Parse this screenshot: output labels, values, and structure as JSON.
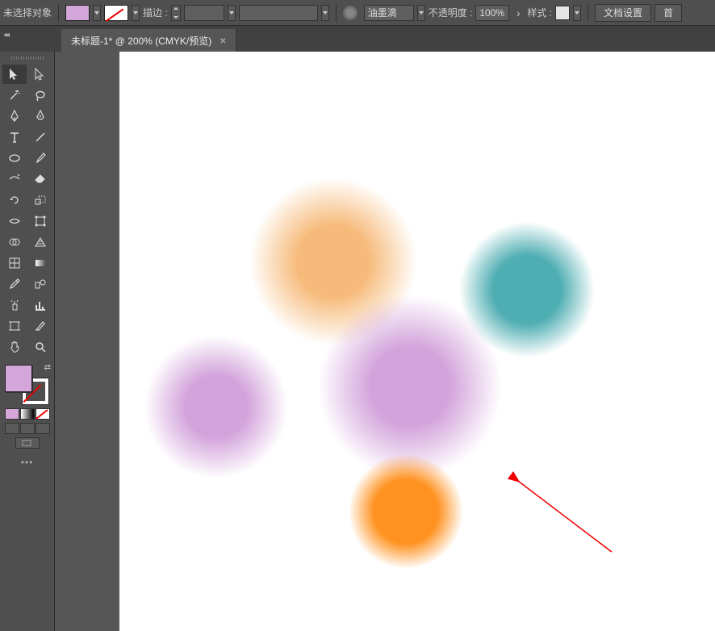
{
  "toolbar": {
    "no_selection": "未选择对象",
    "fill_color": "#d4a6da",
    "stroke_label": "描边 :",
    "stroke_value": "",
    "brush_label": "油墨滴",
    "opacity_label": "不透明度 :",
    "opacity_value": "100%",
    "style_label": "样式 :",
    "doc_settings": "文档设置",
    "prefs": "首"
  },
  "tab": {
    "title": "未标题-1* @ 200% (CMYK/预览)",
    "close": "×"
  },
  "tools": {
    "r0c0": "selection-tool",
    "r0c1": "direct-selection-tool",
    "r1c0": "magic-wand-tool",
    "r1c1": "lasso-tool",
    "r2c0": "pen-tool",
    "r2c1": "curvature-tool",
    "r3c0": "type-tool",
    "r3c1": "line-tool",
    "r4c0": "ellipse-tool",
    "r4c1": "paintbrush-tool",
    "r5c0": "pencil-tool",
    "r5c1": "eraser-tool",
    "r6c0": "rotate-tool",
    "r6c1": "scale-tool",
    "r7c0": "width-tool",
    "r7c1": "free-transform-tool",
    "r8c0": "shape-builder-tool",
    "r8c1": "perspective-grid-tool",
    "r9c0": "mesh-tool",
    "r9c1": "gradient-tool",
    "r10c0": "eyedropper-tool",
    "r10c1": "blend-tool",
    "r11c0": "symbol-sprayer-tool",
    "r11c1": "column-graph-tool",
    "r12c0": "artboard-tool",
    "r12c1": "slice-tool",
    "r13c0": "hand-tool",
    "r13c1": "zoom-tool"
  }
}
